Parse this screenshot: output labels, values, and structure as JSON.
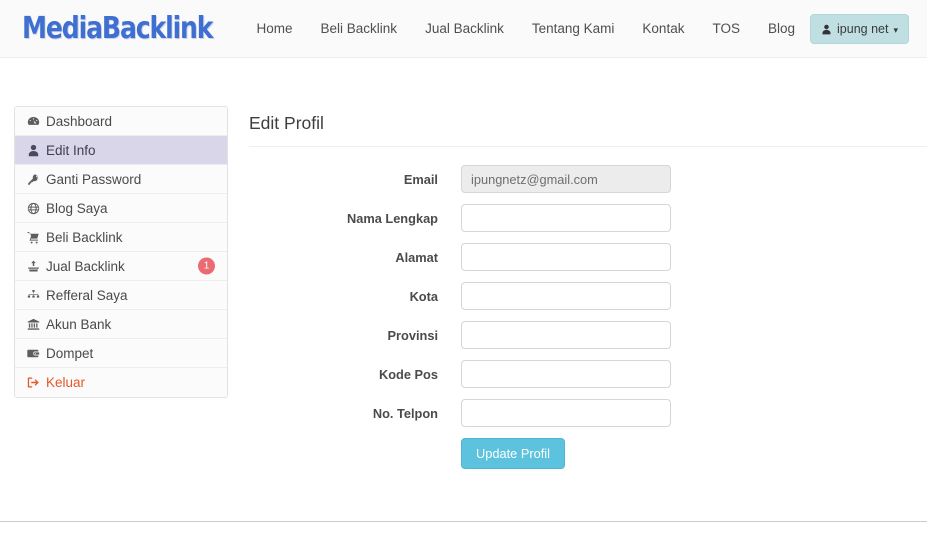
{
  "header": {
    "brand": "MediaBacklink",
    "nav_items": [
      {
        "label": "Home",
        "name": "nav-home"
      },
      {
        "label": "Beli Backlink",
        "name": "nav-beli-backlink"
      },
      {
        "label": "Jual Backlink",
        "name": "nav-jual-backlink"
      },
      {
        "label": "Tentang Kami",
        "name": "nav-tentang-kami"
      },
      {
        "label": "Kontak",
        "name": "nav-kontak"
      },
      {
        "label": "TOS",
        "name": "nav-tos"
      },
      {
        "label": "Blog",
        "name": "nav-blog"
      }
    ],
    "user_menu": {
      "label": "ipung net",
      "icon": "user-icon",
      "caret": "▾",
      "background_color": "#bfdfe3"
    }
  },
  "sidebar": {
    "items": [
      {
        "label": "Dashboard",
        "icon": "tachometer-icon",
        "active": false,
        "badge": ""
      },
      {
        "label": "Edit Info",
        "icon": "user-icon",
        "active": true,
        "badge": ""
      },
      {
        "label": "Ganti Password",
        "icon": "key-icon",
        "active": false,
        "badge": ""
      },
      {
        "label": "Blog Saya",
        "icon": "globe-icon",
        "active": false,
        "badge": ""
      },
      {
        "label": "Beli Backlink",
        "icon": "cart-icon",
        "active": false,
        "badge": ""
      },
      {
        "label": "Jual Backlink",
        "icon": "hand-up-icon",
        "active": false,
        "badge": "1"
      },
      {
        "label": "Refferal Saya",
        "icon": "sitemap-icon",
        "active": false,
        "badge": ""
      },
      {
        "label": "Akun Bank",
        "icon": "bank-icon",
        "active": false,
        "badge": ""
      },
      {
        "label": "Dompet",
        "icon": "wallet-icon",
        "active": false,
        "badge": ""
      },
      {
        "label": "Keluar",
        "icon": "sign-out-icon",
        "active": false,
        "badge": ""
      }
    ],
    "active_background": "#d8d6e8",
    "logout_color": "#e2572a",
    "badge_color": "#ea6b72"
  },
  "main": {
    "title": "Edit Profil",
    "fields": [
      {
        "label": "Email",
        "value": "ipungnetz@gmail.com",
        "placeholder": "",
        "disabled": true
      },
      {
        "label": "Nama Lengkap",
        "value": "",
        "placeholder": "",
        "disabled": false
      },
      {
        "label": "Alamat",
        "value": "",
        "placeholder": "",
        "disabled": false
      },
      {
        "label": "Kota",
        "value": "",
        "placeholder": "",
        "disabled": false
      },
      {
        "label": "Provinsi",
        "value": "",
        "placeholder": "",
        "disabled": false
      },
      {
        "label": "Kode Pos",
        "value": "",
        "placeholder": "",
        "disabled": false
      },
      {
        "label": "No. Telpon",
        "value": "",
        "placeholder": "",
        "disabled": false
      }
    ],
    "submit_label": "Update Profil",
    "submit_color": "#5cc2de"
  }
}
